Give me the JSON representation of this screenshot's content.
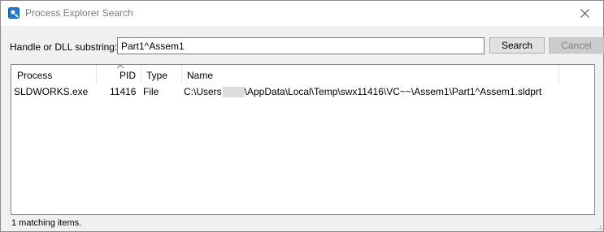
{
  "window": {
    "title": "Process Explorer Search",
    "close_icon": "close-icon",
    "app_icon": "process-explorer-search-icon"
  },
  "search": {
    "label": "Handle or DLL substring:",
    "value": "Part1^Assem1",
    "search_button": "Search",
    "cancel_button": "Cancel"
  },
  "results": {
    "columns": [
      "Process",
      "PID",
      "Type",
      "Name"
    ],
    "sorted_column": "PID",
    "rows": [
      {
        "process": "SLDWORKS.exe",
        "pid": "11416",
        "type": "File",
        "name_prefix": "C:\\Users",
        "name_suffix": "\\AppData\\Local\\Temp\\swx11416\\VC~~\\Assem1\\Part1^Assem1.sldprt"
      }
    ]
  },
  "status": "1 matching items.",
  "colors": {
    "titlebar": "#ffffff",
    "dialog": "#f0f0f0",
    "list_border": "#828790",
    "disabled_text": "#838383"
  }
}
